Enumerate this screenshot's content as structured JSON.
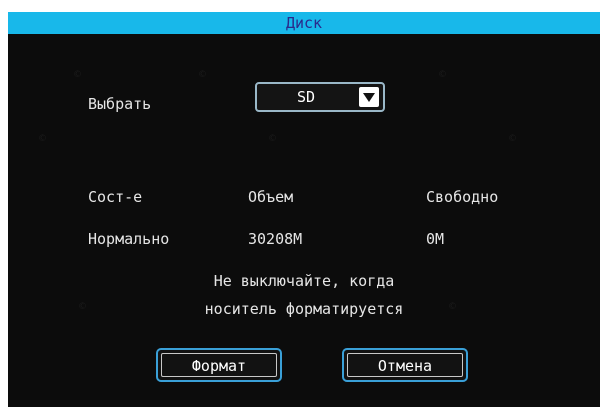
{
  "window": {
    "title": "Диск"
  },
  "select_row": {
    "label": "Выбрать",
    "value": "SD"
  },
  "table": {
    "headers": [
      "Сост-е",
      "Объем",
      "Свободно"
    ],
    "row": [
      "Нормально",
      "30208M",
      "0M"
    ]
  },
  "notice": {
    "line1": "Не выключайте, когда",
    "line2": "носитель форматируется"
  },
  "buttons": {
    "format": "Формат",
    "cancel": "Отмена"
  },
  "colors": {
    "titlebar": "#18b8ea",
    "title_text": "#2a2a8c",
    "background": "#0c0c0c",
    "button_border": "#3aa0d8"
  }
}
